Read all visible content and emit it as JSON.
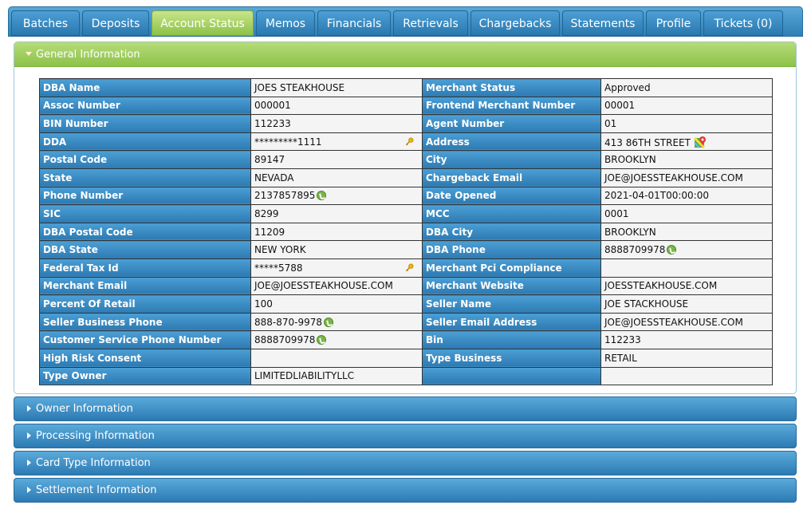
{
  "tabs": [
    {
      "label": "Batches",
      "width": 86
    },
    {
      "label": "Deposits",
      "width": 84
    },
    {
      "label": "Account Status",
      "width": 128,
      "active": true
    },
    {
      "label": "Memos",
      "width": 74
    },
    {
      "label": "Financials",
      "width": 92
    },
    {
      "label": "Retrievals",
      "width": 94
    },
    {
      "label": "Chargebacks",
      "width": 112
    },
    {
      "label": "Statements",
      "width": 102
    },
    {
      "label": "Profile",
      "width": 69
    },
    {
      "label": "Tickets (0)",
      "width": 100
    }
  ],
  "general": {
    "title": "General Information",
    "rows": [
      {
        "l": "DBA Name",
        "lv": "JOES STEAKHOUSE",
        "r": "Merchant Status",
        "rv": "Approved"
      },
      {
        "l": "Assoc Number",
        "lv": "000001",
        "r": "Frontend Merchant Number",
        "rv": "00001"
      },
      {
        "l": "BIN Number",
        "lv": "112233",
        "r": "Agent Number",
        "rv": "01"
      },
      {
        "l": "DDA",
        "lv": "*********1111",
        "lkey": true,
        "r": "Address",
        "rv": "413 86TH STREET",
        "rmap": true
      },
      {
        "l": "Postal Code",
        "lv": "89147",
        "r": "City",
        "rv": "BROOKLYN"
      },
      {
        "l": "State",
        "lv": "NEVADA",
        "r": "Chargeback Email",
        "rv": "JOE@JOESSTEAKHOUSE.COM"
      },
      {
        "l": "Phone Number",
        "lv": "2137857895",
        "lphone": true,
        "r": "Date Opened",
        "rv": "2021-04-01T00:00:00"
      },
      {
        "l": "SIC",
        "lv": "8299",
        "r": "MCC",
        "rv": "0001"
      },
      {
        "l": "DBA Postal Code",
        "lv": "11209",
        "r": "DBA City",
        "rv": "BROOKLYN"
      },
      {
        "l": "DBA State",
        "lv": "NEW YORK",
        "r": "DBA Phone",
        "rv": "8888709978",
        "rphone": true
      },
      {
        "l": "Federal Tax Id",
        "lv": "*****5788",
        "lkey": true,
        "r": "Merchant Pci Compliance",
        "rv": ""
      },
      {
        "l": "Merchant Email",
        "lv": "JOE@JOESSTEAKHOUSE.COM",
        "r": "Merchant Website",
        "rv": "JOESSTEAKHOUSE.COM"
      },
      {
        "l": "Percent Of Retail",
        "lv": "100",
        "r": "Seller Name",
        "rv": "JOE STACKHOUSE"
      },
      {
        "l": "Seller Business Phone",
        "lv": "888-870-9978",
        "lphone": true,
        "r": "Seller Email Address",
        "rv": "JOE@JOESSTEAKHOUSE.COM"
      },
      {
        "l": "Customer Service Phone Number",
        "lv": "8888709978",
        "lphone": true,
        "r": "Bin",
        "rv": "112233"
      },
      {
        "l": "High Risk Consent",
        "lv": "",
        "r": "Type Business",
        "rv": "RETAIL"
      },
      {
        "l": "Type Owner",
        "lv": "LIMITEDLIABILITYLLC",
        "r": "",
        "rv": ""
      }
    ]
  },
  "sections": [
    {
      "label": "Owner Information"
    },
    {
      "label": "Processing Information"
    },
    {
      "label": "Card Type Information"
    },
    {
      "label": "Settlement Information"
    }
  ],
  "colors": {
    "tab_blue": "#2f7fb5",
    "tab_active_green": "#8cc147",
    "label_cell_blue": "#2c7ab3",
    "value_cell_bg": "#f4f4f4"
  },
  "icons": {
    "phone": "phone-icon",
    "key": "key-icon",
    "map": "map-pin-icon"
  }
}
